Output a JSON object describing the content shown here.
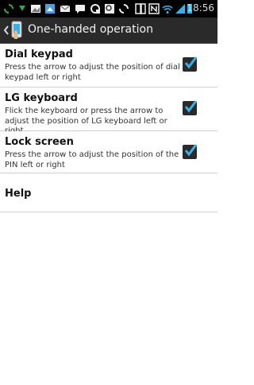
{
  "statusbar": {
    "time": "18:56",
    "icons": [
      "sync-icon",
      "download-icon",
      "image-icon",
      "gallery-icon",
      "mail-icon",
      "screenshot-icon",
      "search-icon",
      "sync-icon",
      "phone-icon",
      "nfc-icon",
      "wifi-icon",
      "signal-icon",
      "battery-icon"
    ]
  },
  "header": {
    "title": "One-handed operation",
    "back_icon": "back-chevron-icon",
    "app_icon": "hand-phone-icon"
  },
  "settings": [
    {
      "title": "Dial keypad",
      "description": "Press the arrow to adjust the position of dial keypad left or right",
      "checked": true
    },
    {
      "title": "LG keyboard",
      "description": "Flick the keyboard or press the arrow to adjust the position of LG keyboard left or right",
      "checked": true
    },
    {
      "title": "Lock screen",
      "description": "Press the arrow to adjust the position of the PIN left or right",
      "checked": true
    }
  ],
  "help": {
    "title": "Help"
  },
  "colors": {
    "accent": "#3ab0e6",
    "statusbar_bg": "#000000",
    "actionbar_bg": "#2a2a2a"
  }
}
